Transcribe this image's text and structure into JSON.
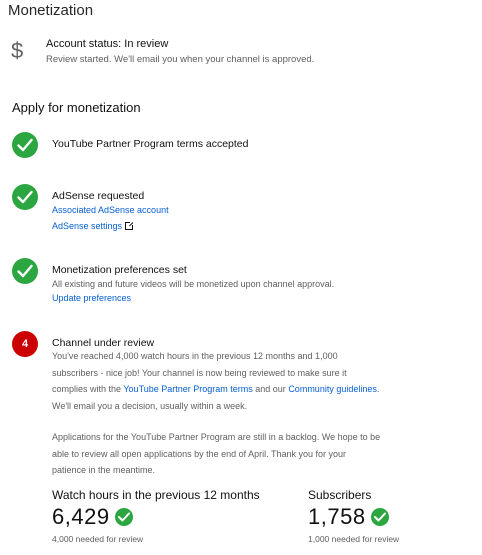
{
  "page": {
    "title": "Monetization"
  },
  "account": {
    "icon": "dollar-icon",
    "status": "Account status: In review",
    "description": "Review started. We'll email you when your channel is approved."
  },
  "apply": {
    "title": "Apply for monetization",
    "steps": [
      {
        "state": "complete",
        "title": "YouTube Partner Program terms accepted"
      },
      {
        "state": "complete",
        "title": "AdSense requested",
        "link1": "Associated AdSense account",
        "link2": "AdSense settings"
      },
      {
        "state": "complete",
        "title": "Monetization preferences set",
        "text": "All existing and future videos will be monetized upon channel approval.",
        "link": "Update preferences"
      },
      {
        "state": "current",
        "badge": "4",
        "title": "Channel under review",
        "p1_line1": "You've reached 4,000 watch hours in the previous 12 months and 1,000",
        "p1_line2": "subscribers - nice job! Your channel is now being reviewed to make sure it",
        "p1_line3_pre": "complies with the ",
        "p1_link_terms": "YouTube Partner Program terms",
        "p1_line3_mid": " and our ",
        "p1_link_guidelines": "Community guidelines",
        "p1_line3_post": ".",
        "p1_line4": "We'll email you a decision, usually within a week.",
        "p2_line1": "Applications for the YouTube Partner Program are still in a backlog. We hope to be",
        "p2_line2": "able to review all open applications by the end of April. Thank you for your",
        "p2_line3": "patience in the meantime."
      }
    ]
  },
  "stats": {
    "watch_hours": {
      "label": "Watch hours in the previous 12 months",
      "value": "6,429",
      "needed": "4,000 needed for review"
    },
    "subscribers": {
      "label": "Subscribers",
      "value": "1,758",
      "needed": "1,000 needed for review"
    }
  },
  "colors": {
    "success": "#2ba640",
    "alert": "#cc0000",
    "link": "#065fd4"
  }
}
